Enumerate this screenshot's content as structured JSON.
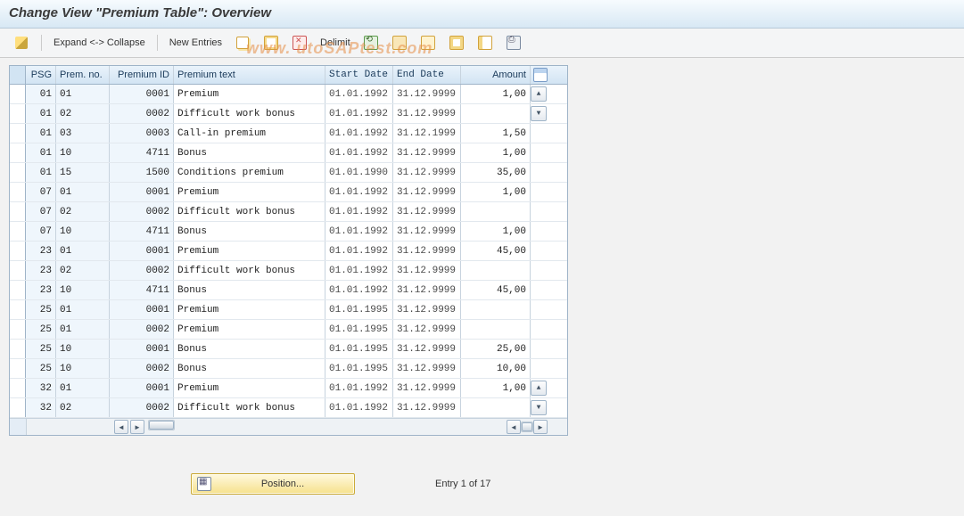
{
  "title": "Change View \"Premium Table\": Overview",
  "watermark": "www. utoSAPtest.com",
  "toolbar": {
    "edit_tip": "Toggle",
    "expand": "Expand <-> Collapse",
    "new_entries": "New Entries",
    "delimit": "Delimit"
  },
  "columns": {
    "psg": "PSG",
    "prem_no": "Prem. no.",
    "prem_id": "Premium ID",
    "prem_text": "Premium text",
    "start": "Start Date",
    "end": "End Date",
    "amount": "Amount"
  },
  "rows": [
    {
      "psg": "01",
      "pno": "01",
      "pid": "0001",
      "txt": "Premium",
      "sd": "01.01.1992",
      "ed": "31.12.9999",
      "amt": "1,00"
    },
    {
      "psg": "01",
      "pno": "02",
      "pid": "0002",
      "txt": "Difficult work bonus",
      "sd": "01.01.1992",
      "ed": "31.12.9999",
      "amt": ""
    },
    {
      "psg": "01",
      "pno": "03",
      "pid": "0003",
      "txt": "Call-in premium",
      "sd": "01.01.1992",
      "ed": "31.12.1999",
      "amt": "1,50"
    },
    {
      "psg": "01",
      "pno": "10",
      "pid": "4711",
      "txt": "Bonus",
      "sd": "01.01.1992",
      "ed": "31.12.9999",
      "amt": "1,00"
    },
    {
      "psg": "01",
      "pno": "15",
      "pid": "1500",
      "txt": "Conditions premium",
      "sd": "01.01.1990",
      "ed": "31.12.9999",
      "amt": "35,00"
    },
    {
      "psg": "07",
      "pno": "01",
      "pid": "0001",
      "txt": "Premium",
      "sd": "01.01.1992",
      "ed": "31.12.9999",
      "amt": "1,00"
    },
    {
      "psg": "07",
      "pno": "02",
      "pid": "0002",
      "txt": "Difficult work bonus",
      "sd": "01.01.1992",
      "ed": "31.12.9999",
      "amt": ""
    },
    {
      "psg": "07",
      "pno": "10",
      "pid": "4711",
      "txt": "Bonus",
      "sd": "01.01.1992",
      "ed": "31.12.9999",
      "amt": "1,00"
    },
    {
      "psg": "23",
      "pno": "01",
      "pid": "0001",
      "txt": "Premium",
      "sd": "01.01.1992",
      "ed": "31.12.9999",
      "amt": "45,00"
    },
    {
      "psg": "23",
      "pno": "02",
      "pid": "0002",
      "txt": "Difficult work bonus",
      "sd": "01.01.1992",
      "ed": "31.12.9999",
      "amt": ""
    },
    {
      "psg": "23",
      "pno": "10",
      "pid": "4711",
      "txt": "Bonus",
      "sd": "01.01.1992",
      "ed": "31.12.9999",
      "amt": "45,00"
    },
    {
      "psg": "25",
      "pno": "01",
      "pid": "0001",
      "txt": "Premium",
      "sd": "01.01.1995",
      "ed": "31.12.9999",
      "amt": ""
    },
    {
      "psg": "25",
      "pno": "01",
      "pid": "0002",
      "txt": "Premium",
      "sd": "01.01.1995",
      "ed": "31.12.9999",
      "amt": ""
    },
    {
      "psg": "25",
      "pno": "10",
      "pid": "0001",
      "txt": "Bonus",
      "sd": "01.01.1995",
      "ed": "31.12.9999",
      "amt": "25,00"
    },
    {
      "psg": "25",
      "pno": "10",
      "pid": "0002",
      "txt": "Bonus",
      "sd": "01.01.1995",
      "ed": "31.12.9999",
      "amt": "10,00"
    },
    {
      "psg": "32",
      "pno": "01",
      "pid": "0001",
      "txt": "Premium",
      "sd": "01.01.1992",
      "ed": "31.12.9999",
      "amt": "1,00"
    },
    {
      "psg": "32",
      "pno": "02",
      "pid": "0002",
      "txt": "Difficult work bonus",
      "sd": "01.01.1992",
      "ed": "31.12.9999",
      "amt": ""
    }
  ],
  "footer": {
    "position_label": "Position...",
    "entry_status": "Entry 1 of 17"
  }
}
